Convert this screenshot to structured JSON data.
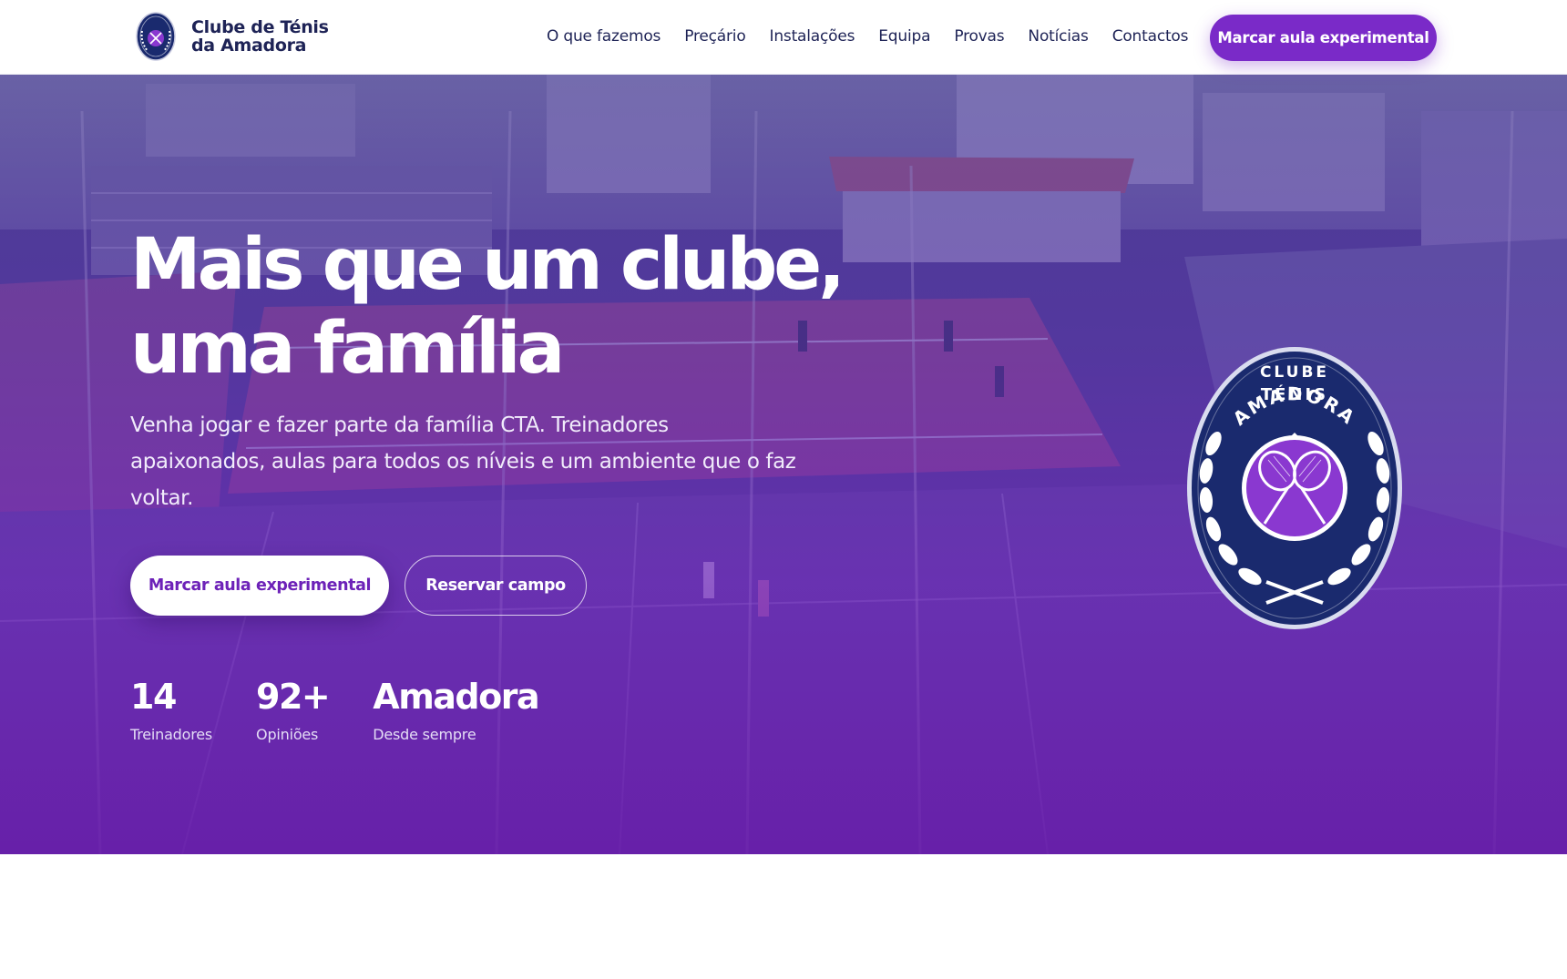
{
  "header": {
    "brand_line1": "Clube de Ténis",
    "brand_line2": "da Amadora",
    "nav": [
      {
        "label": "O que fazemos"
      },
      {
        "label": "Preçário"
      },
      {
        "label": "Instalações"
      },
      {
        "label": "Equipa"
      },
      {
        "label": "Provas"
      },
      {
        "label": "Notícias"
      },
      {
        "label": "Contactos"
      }
    ],
    "cta_label": "Marcar aula experimental"
  },
  "hero": {
    "title": "Mais que um clube, uma família",
    "subtitle": "Venha jogar e fazer parte da família CTA. Treinadores apaixonados, aulas para todos os níveis e um ambiente que o faz voltar.",
    "primary_button": "Marcar aula experimental",
    "secondary_button": "Reservar campo",
    "stats": [
      {
        "value": "14",
        "label": "Treinadores"
      },
      {
        "value": "92+",
        "label": "Opiniões"
      },
      {
        "value": "Amadora",
        "label": "Desde sempre"
      }
    ],
    "emblem_text": [
      "CLUBE",
      "TÉNIS",
      "AMADORA"
    ]
  },
  "colors": {
    "brand_purple": "#7a2ac8",
    "navy": "#1e2356",
    "emblem_navy": "#1a2a6e",
    "hero_overlay_bottom": "#681caa"
  },
  "icons": {
    "logo": "club-crest-icon",
    "emblem": "tennis-rackets-crest-icon"
  }
}
